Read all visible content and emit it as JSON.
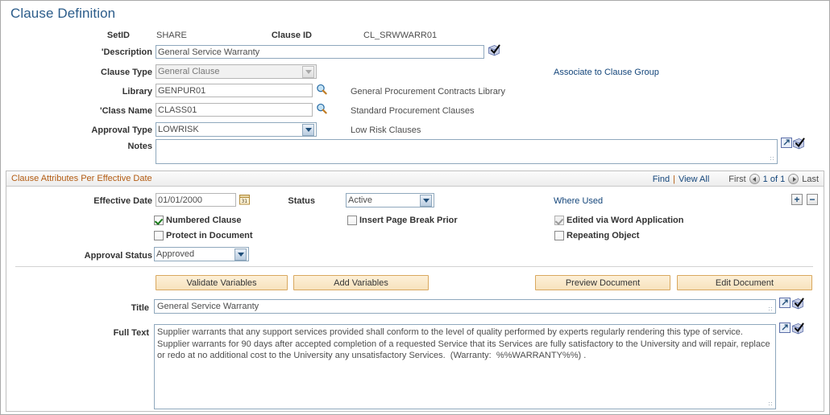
{
  "page": {
    "title": "Clause Definition"
  },
  "header_fields": {
    "setid_label": "SetID",
    "setid_value": "SHARE",
    "clause_id_label": "Clause ID",
    "clause_id_value": "CL_SRWWARR01",
    "description_label": "'Description",
    "description_value": "General Service Warranty",
    "clause_type_label": "Clause Type",
    "clause_type_value": "General Clause",
    "library_label": "Library",
    "library_value": "GENPUR01",
    "library_desc": "General Procurement Contracts Library",
    "class_name_label": "'Class Name",
    "class_name_value": "CLASS01",
    "class_name_desc": "Standard Procurement Clauses",
    "approval_type_label": "Approval Type",
    "approval_type_value": "LOWRISK",
    "approval_type_desc": "Low Risk Clauses",
    "notes_label": "Notes",
    "notes_value": "",
    "associate_link": "Associate to Clause Group"
  },
  "attributes_section": {
    "title": "Clause Attributes Per Effective Date",
    "find_label": "Find",
    "separator": "|",
    "view_all_label": "View All",
    "first_label": "First",
    "page_count": "1 of 1",
    "last_label": "Last",
    "add_row_label": "+",
    "delete_row_label": "−",
    "effective_date_label": "Effective Date",
    "effective_date_value": "01/01/2000",
    "status_label": "Status",
    "status_value": "Active",
    "where_used_link": "Where Used",
    "checkboxes": [
      {
        "name": "numbered-clause",
        "label": "Numbered Clause",
        "checked": true,
        "disabled": false
      },
      {
        "name": "protect-in-document",
        "label": "Protect in Document",
        "checked": false,
        "disabled": false
      },
      {
        "name": "insert-page-break",
        "label": "Insert Page Break Prior",
        "checked": false,
        "disabled": false
      },
      {
        "name": "edited-via-word",
        "label": "Edited via Word Application",
        "checked": true,
        "disabled": true
      },
      {
        "name": "repeating-object",
        "label": "Repeating Object",
        "checked": false,
        "disabled": false
      }
    ],
    "approval_status_label": "Approval Status",
    "approval_status_value": "Approved"
  },
  "buttons": {
    "validate_variables": "Validate Variables",
    "add_variables": "Add Variables",
    "preview_document": "Preview Document",
    "edit_document": "Edit Document"
  },
  "content": {
    "title_label": "Title",
    "title_value": "General Service Warranty",
    "full_text_label": "Full Text",
    "full_text_value": "Supplier warrants that any support services provided shall conform to the level of quality performed by experts regularly rendering this type of service.  Supplier warrants for 90 days after accepted completion of a requested Service that its Services are fully satisfactory to the University and will repair, replace or redo at no additional cost to the University any unsatisfactory Services.  (Warranty:  %%WARRANTY%%) ."
  },
  "colors": {
    "title_blue": "#2b5c8a",
    "link_blue": "#13457a",
    "group_title_orange": "#b35c12",
    "button_tan": "#f7e2bd",
    "check_green": "#1a7a1a"
  }
}
